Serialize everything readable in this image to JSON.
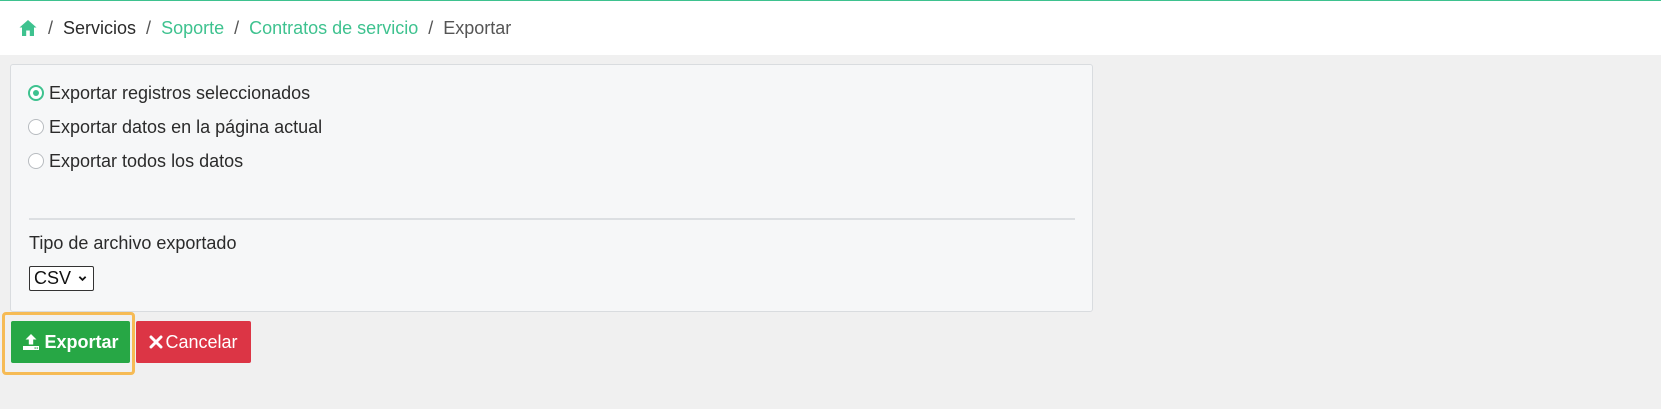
{
  "breadcrumb": {
    "home_icon": "home-icon",
    "items": [
      {
        "label": "Servicios"
      },
      {
        "label": "Soporte"
      },
      {
        "label": "Contratos de servicio"
      },
      {
        "label": "Exportar"
      }
    ],
    "separator": "/"
  },
  "export_options": {
    "selected_index": 0,
    "options": [
      {
        "label": "Exportar registros seleccionados"
      },
      {
        "label": "Exportar datos en la página actual"
      },
      {
        "label": "Exportar todos los datos"
      }
    ]
  },
  "file_type": {
    "label": "Tipo de archivo exportado",
    "selected": "CSV"
  },
  "actions": {
    "export_label": "Exportar",
    "export_icon": "upload-icon",
    "cancel_label": "Cancelar",
    "cancel_icon": "close-icon"
  },
  "colors": {
    "accent": "#3ec28f",
    "export_button": "#27a745",
    "cancel_button": "#dc3545",
    "focus_ring": "#f6bb55"
  }
}
